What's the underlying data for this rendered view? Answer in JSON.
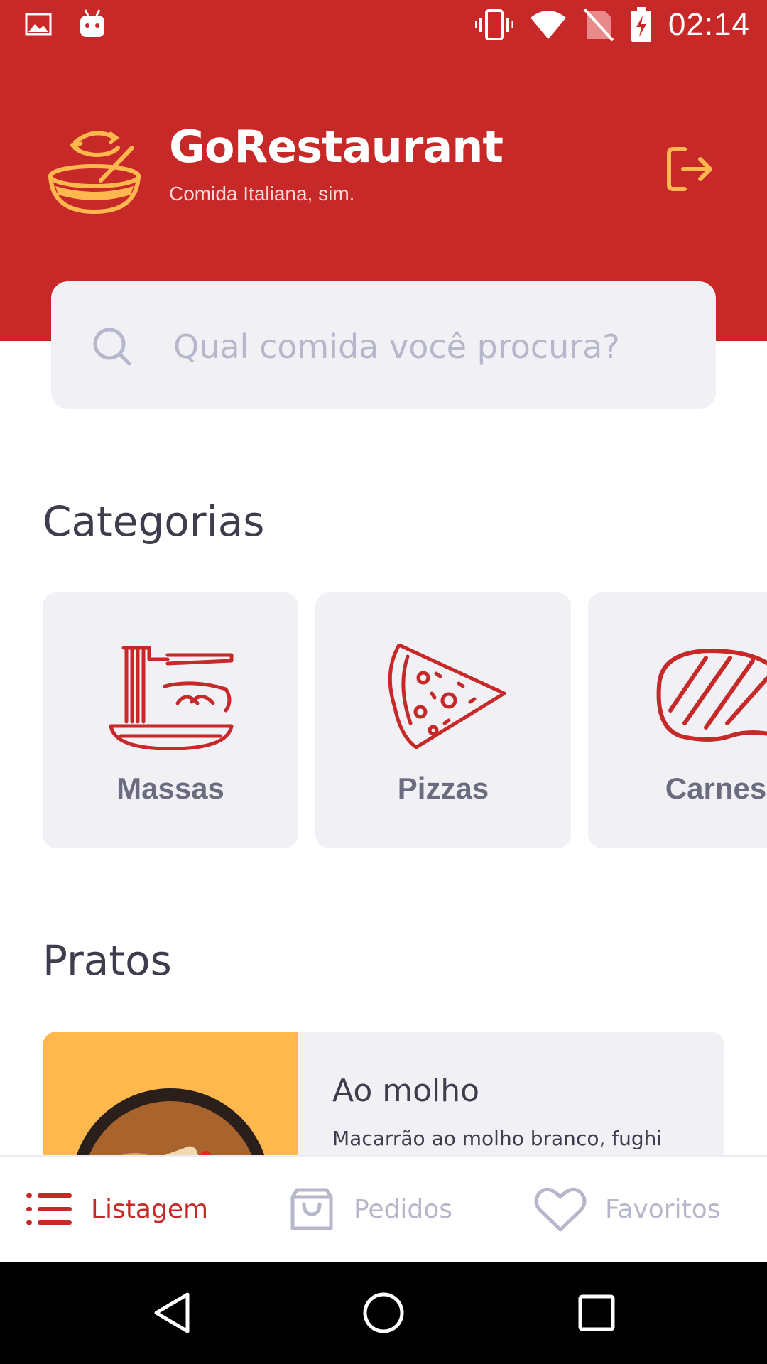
{
  "status_bar": {
    "time": "02:14",
    "icons": [
      "image-icon",
      "android-icon",
      "vibrate-icon",
      "wifi-icon",
      "no-sim-icon",
      "battery-charging-icon"
    ]
  },
  "header": {
    "title": "GoRestaurant",
    "subtitle": "Comida Italiana, sim.",
    "logo_icon": "bowl-logo-icon",
    "logout_icon": "logout-icon",
    "background_color": "#c72828",
    "accent_color": "#ffb84d"
  },
  "search": {
    "placeholder": "Qual comida você procura?",
    "value": ""
  },
  "categories": {
    "title": "Categorias",
    "items": [
      {
        "label": "Massas",
        "icon": "pasta-icon"
      },
      {
        "label": "Pizzas",
        "icon": "pizza-icon"
      },
      {
        "label": "Carnes",
        "icon": "steak-icon"
      }
    ]
  },
  "dishes": {
    "title": "Pratos",
    "items": [
      {
        "name": "Ao molho",
        "description": "Macarrão ao molho branco, fughi"
      }
    ]
  },
  "tabbar": {
    "tabs": [
      {
        "label": "Listagem",
        "icon": "list-icon",
        "active": true
      },
      {
        "label": "Pedidos",
        "icon": "shopping-bag-icon",
        "active": false
      },
      {
        "label": "Favoritos",
        "icon": "heart-icon",
        "active": false
      }
    ],
    "active_color": "#c72828",
    "inactive_color": "#b7b7cc"
  },
  "navbar": {
    "icons": [
      "back-icon",
      "home-icon",
      "recents-icon"
    ]
  }
}
